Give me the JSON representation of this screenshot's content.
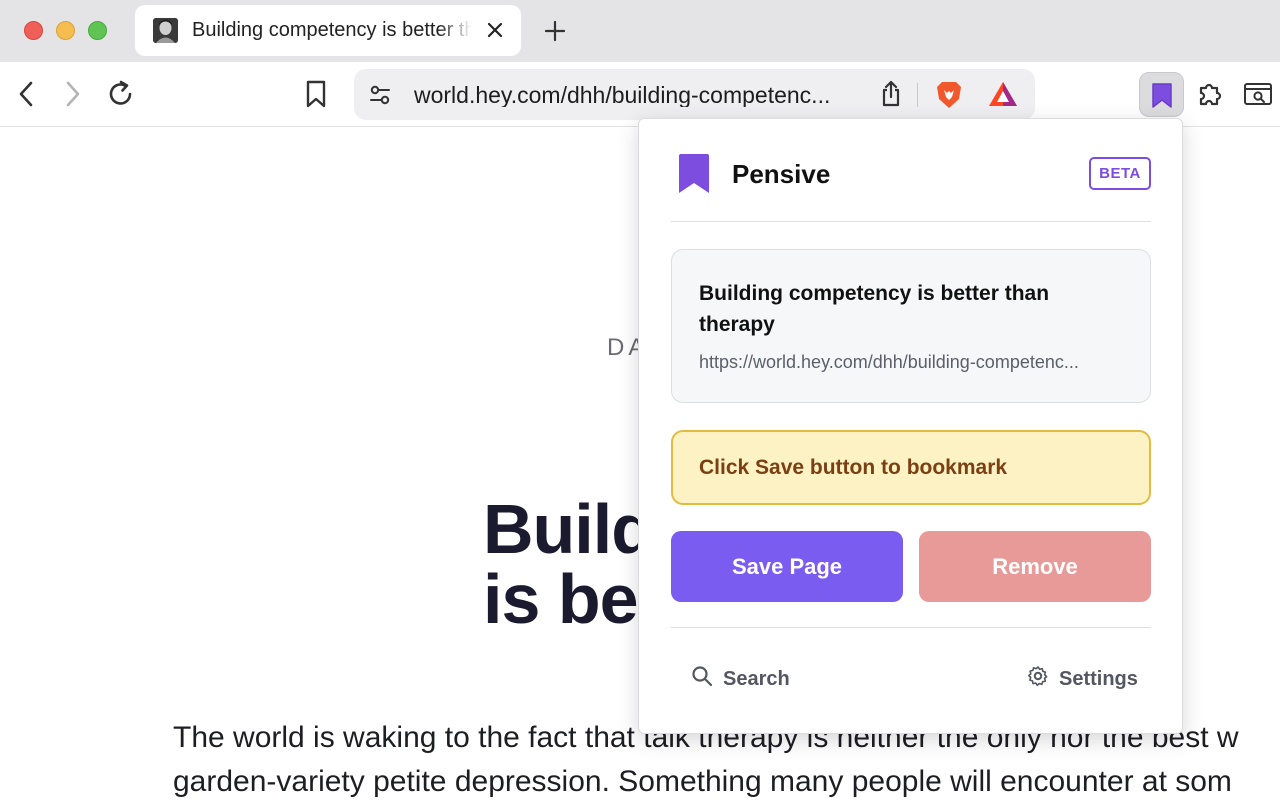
{
  "browser": {
    "tab": {
      "title": "Building competency is better than therapy"
    },
    "address_bar": {
      "url": "world.hey.com/dhh/building-competenc..."
    }
  },
  "page": {
    "author_partial": "DA",
    "headline_line1": "Build",
    "headline_line2": "is bet",
    "body_line1": "The world is waking to the fact that talk therapy is neither the only nor the best w",
    "body_line2": "garden-variety petite depression. Something many people will encounter at som"
  },
  "popup": {
    "app_name": "Pensive",
    "badge": "BETA",
    "card": {
      "title": "Building competency is better than therapy",
      "url": "https://world.hey.com/dhh/building-competenc..."
    },
    "notice": "Click Save button to bookmark",
    "save_label": "Save Page",
    "remove_label": "Remove",
    "search_label": "Search",
    "settings_label": "Settings"
  },
  "colors": {
    "brand_purple": "#7b5cf0",
    "remove_red": "#e79a97",
    "notice_bg": "#fdf2c4",
    "notice_text": "#7a3f12"
  }
}
